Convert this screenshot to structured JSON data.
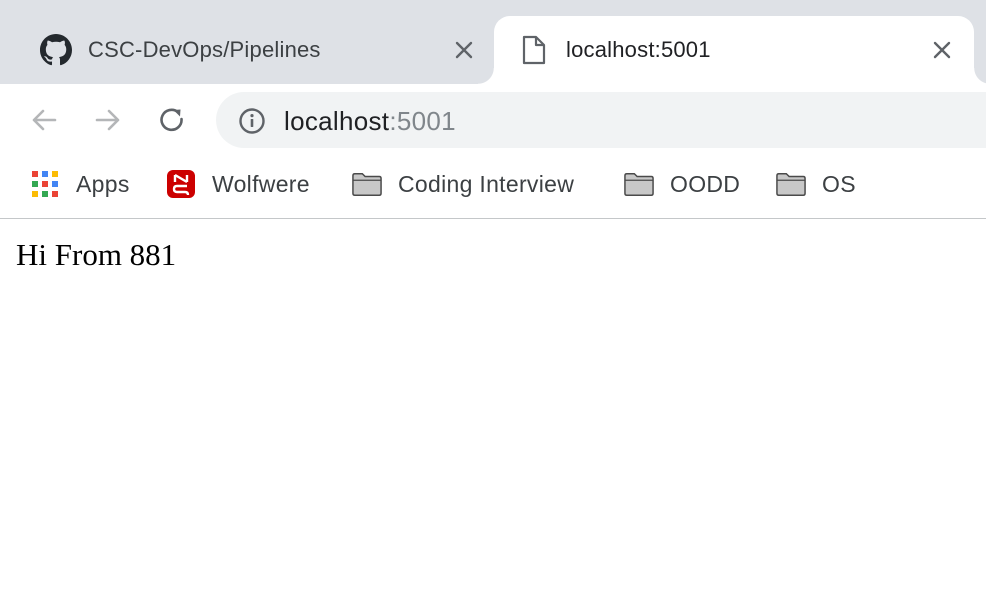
{
  "tabs": [
    {
      "title": "CSC-DevOps/Pipelines",
      "favicon": "github-icon",
      "active": false
    },
    {
      "title": "localhost:5001",
      "favicon": "document-icon",
      "active": true
    }
  ],
  "toolbar": {
    "back_icon": "back-arrow-icon",
    "forward_icon": "forward-arrow-icon",
    "reload_icon": "reload-icon",
    "address": {
      "host": "localhost",
      "port": ":5001",
      "security_icon": "info-icon"
    }
  },
  "bookmarks": [
    {
      "label": "Apps",
      "icon": "apps-grid-icon"
    },
    {
      "label": "Wolfwere",
      "icon": "ncstate-logo-icon"
    },
    {
      "label": "Coding Interview",
      "icon": "folder-icon"
    },
    {
      "label": "OODD",
      "icon": "folder-icon"
    },
    {
      "label": "OS",
      "icon": "folder-icon"
    }
  ],
  "page": {
    "body_text": "Hi From 881"
  },
  "colors": {
    "tabstrip_bg": "#dee1e6",
    "omnibox_bg": "#f1f3f4",
    "text_primary": "#202124",
    "text_muted": "#80868b",
    "ncstate_red": "#cc0000"
  }
}
